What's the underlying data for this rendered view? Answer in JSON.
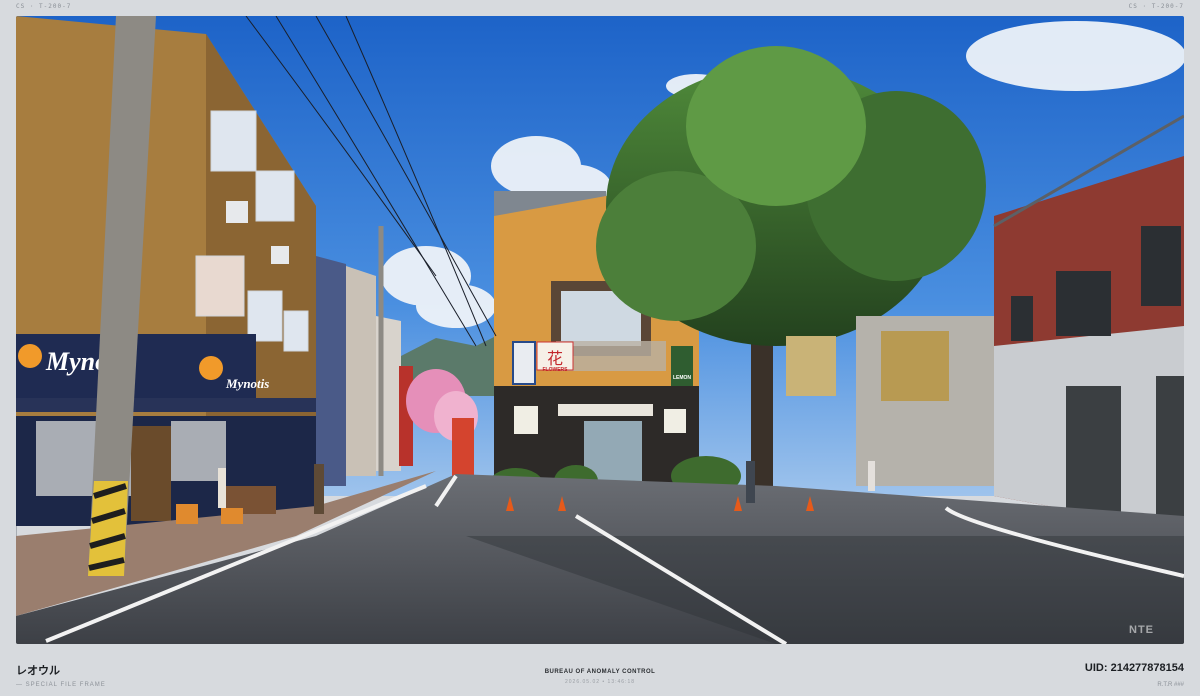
{
  "frame": {
    "top_left_code": "CS · T-200-7",
    "top_right_code": "CS · T-200-7"
  },
  "scene": {
    "store_sign_left": "Mynotis",
    "store_sign_right": "Mynotis",
    "flower_shop_sign": "FLOWERS",
    "flower_shop_vertical": "四季物語",
    "flower_char": "花",
    "lemon_sign": "LEMON",
    "watermark": "NTE"
  },
  "footer": {
    "left_title": "レオウル",
    "left_sub": "— SPECIAL FILE FRAME",
    "center_title": "BUREAU OF ANOMALY CONTROL",
    "center_sub": "2026.05.02 • 13:46:18",
    "right_title": "UID: 214277878154",
    "right_sub": "R.T.R ###"
  }
}
